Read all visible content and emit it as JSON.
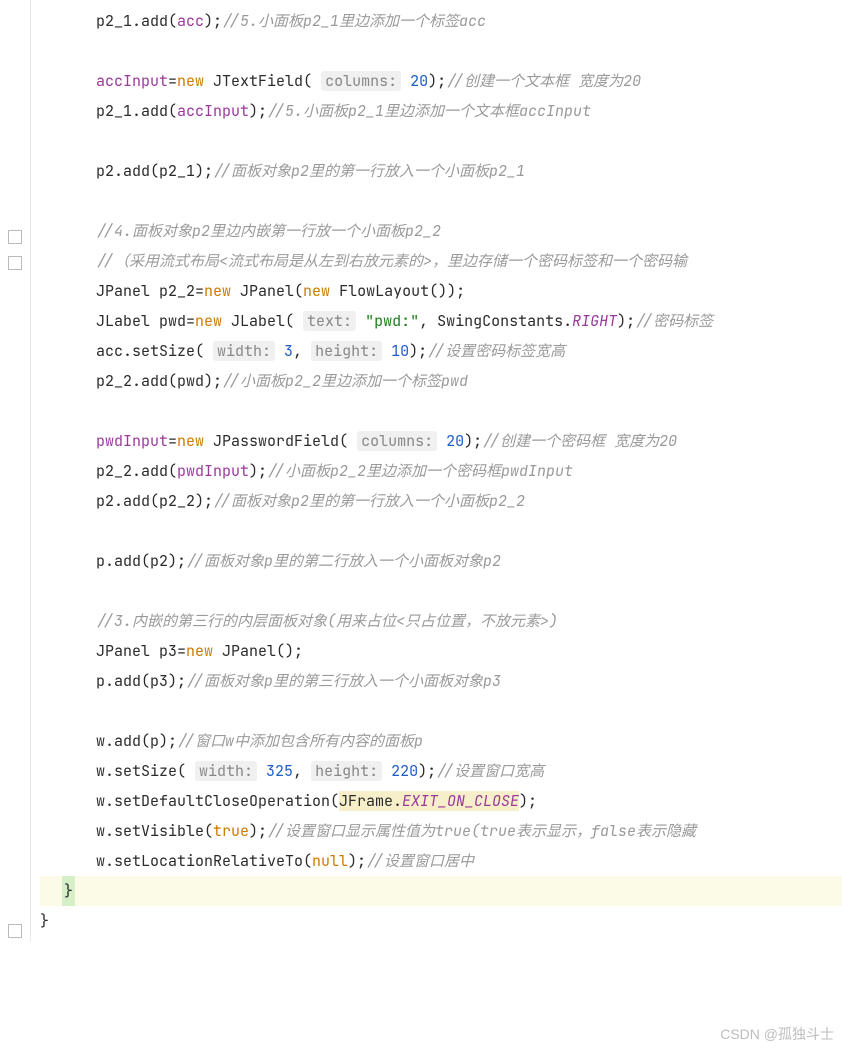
{
  "watermark": "CSDN @孤独斗士",
  "lines": {
    "l1": {
      "a": "p2_1.add(",
      "b": "acc",
      "c": ");",
      "cm": "//5.小面板p2_1里边添加一个标签acc"
    },
    "l2": {
      "a": "accInput",
      "b": "=",
      "c": "new",
      "d": " JTextField( ",
      "e": "columns:",
      "f": "20",
      "g": ");",
      "cm": "//创建一个文本框 宽度为20"
    },
    "l3": {
      "a": "p2_1.add(",
      "b": "accInput",
      "c": ");",
      "cm": "//5.小面板p2_1里边添加一个文本框accInput"
    },
    "l4": {
      "a": "p2.add(p2_1);",
      "cm": "//面板对象p2里的第一行放入一个小面板p2_1"
    },
    "l5": "//4.面板对象p2里边内嵌第一行放一个小面板p2_2",
    "l6": "//（采用流式布局<流式布局是从左到右放元素的>，里边存储一个密码标签和一个密码输",
    "l7": {
      "a": "JPanel p2_2=",
      "b": "new",
      "c": " JPanel(",
      "d": "new",
      "e": " FlowLayout());"
    },
    "l8": {
      "a": "JLabel pwd=",
      "b": "new",
      "c": " JLabel( ",
      "d": "text:",
      "e": "\"pwd:\"",
      "f": ", SwingConstants.",
      "g": "RIGHT",
      "h": ");",
      "cm": "//密码标签"
    },
    "l9": {
      "a": "acc.setSize( ",
      "b": "width:",
      "c": "3",
      "d": ", ",
      "e": "height:",
      "f": "10",
      "g": ");",
      "cm": "//设置密码标签宽高"
    },
    "l10": {
      "a": "p2_2.add(pwd);",
      "cm": "//小面板p2_2里边添加一个标签pwd"
    },
    "l11": {
      "a": "pwdInput",
      "b": "=",
      "c": "new",
      "d": " JPasswordField( ",
      "e": "columns:",
      "f": "20",
      "g": ");",
      "cm": "//创建一个密码框 宽度为20"
    },
    "l12": {
      "a": "p2_2.add(",
      "b": "pwdInput",
      "c": ");",
      "cm": "//小面板p2_2里边添加一个密码框pwdInput"
    },
    "l13": {
      "a": "p2.add(p2_2);",
      "cm": "//面板对象p2里的第一行放入一个小面板p2_2"
    },
    "l14": {
      "a": "p.add(p2);",
      "cm": "//面板对象p里的第二行放入一个小面板对象p2"
    },
    "l15": "//3.内嵌的第三行的内层面板对象(用来占位<只占位置，不放元素>)",
    "l16": {
      "a": "JPanel p3=",
      "b": "new",
      "c": " JPanel();"
    },
    "l17": {
      "a": "p.add(p3);",
      "cm": "//面板对象p里的第三行放入一个小面板对象p3"
    },
    "l18": {
      "a": "w.add(p);",
      "cm": "//窗口w中添加包含所有内容的面板p"
    },
    "l19": {
      "a": "w.setSize( ",
      "b": "width:",
      "c": "325",
      "d": ", ",
      "e": "height:",
      "f": "220",
      "g": ");",
      "cm": "//设置窗口宽高"
    },
    "l20": {
      "a": "w.setDefaultCloseOperation(",
      "b": "JFrame.",
      "c": "EXIT_ON_CLOSE",
      "d": ");"
    },
    "l21": {
      "a": "w.setVisible(",
      "b": "true",
      "c": ");",
      "cm": "//设置窗口显示属性值为true(true表示显示，false表示隐藏"
    },
    "l22": {
      "a": "w.setLocationRelativeTo(",
      "b": "null",
      "c": ");",
      "cm": "//设置窗口居中"
    },
    "l23": "}",
    "l24": "}"
  }
}
